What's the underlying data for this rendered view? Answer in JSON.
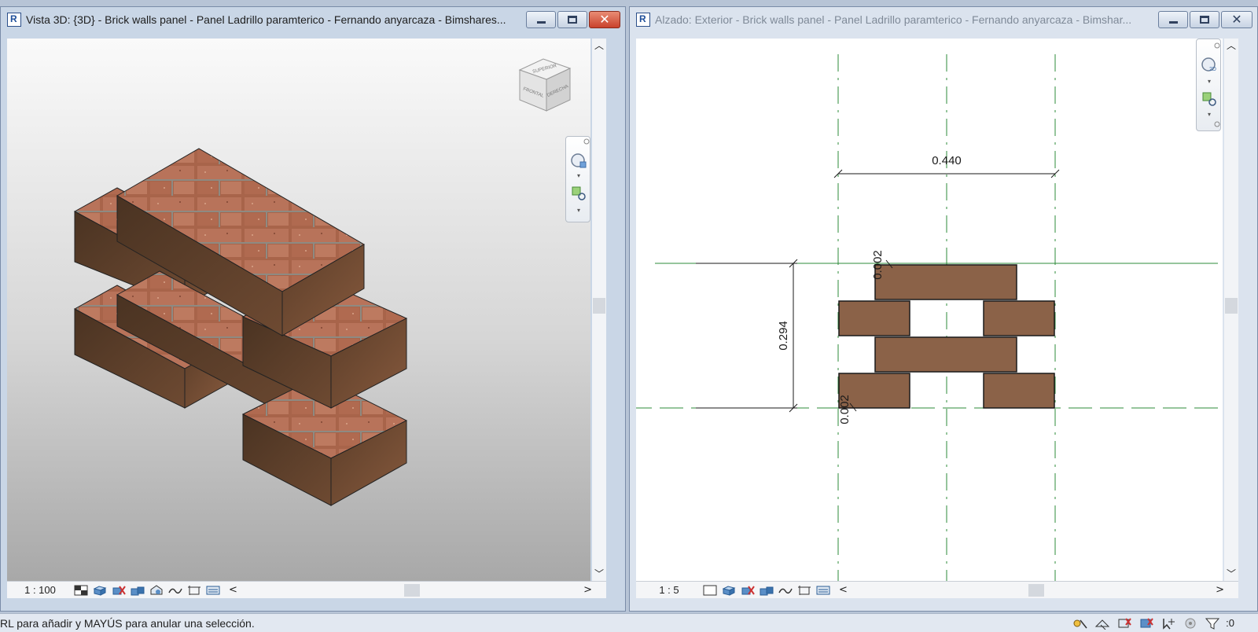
{
  "left_window": {
    "title": "Vista 3D: {3D} - Brick walls panel - Panel Ladrillo paramterico - Fernando anyarcaza - Bimshares...",
    "scale": "1 : 100",
    "viewcube": {
      "top_face": "SUPERIOR",
      "front_face": "FRONTAL",
      "right_face": "DERECHA"
    }
  },
  "right_window": {
    "title": "Alzado: Exterior - Brick walls panel - Panel Ladrillo paramterico - Fernando anyarcaza - Bimshar...",
    "scale": "1 : 5",
    "dimensions": {
      "width": "0.440",
      "height": "0.294",
      "top_gap": "0.002",
      "bottom_gap": "0.002"
    }
  },
  "status_bar": {
    "message": "RL para añadir y MAYÚS para anular una selección.",
    "filter_count": ":0"
  },
  "colors": {
    "brick_fill": "#8b6248",
    "reference_line": "#2e8b3a",
    "title_bar": "#c9d6e6"
  }
}
